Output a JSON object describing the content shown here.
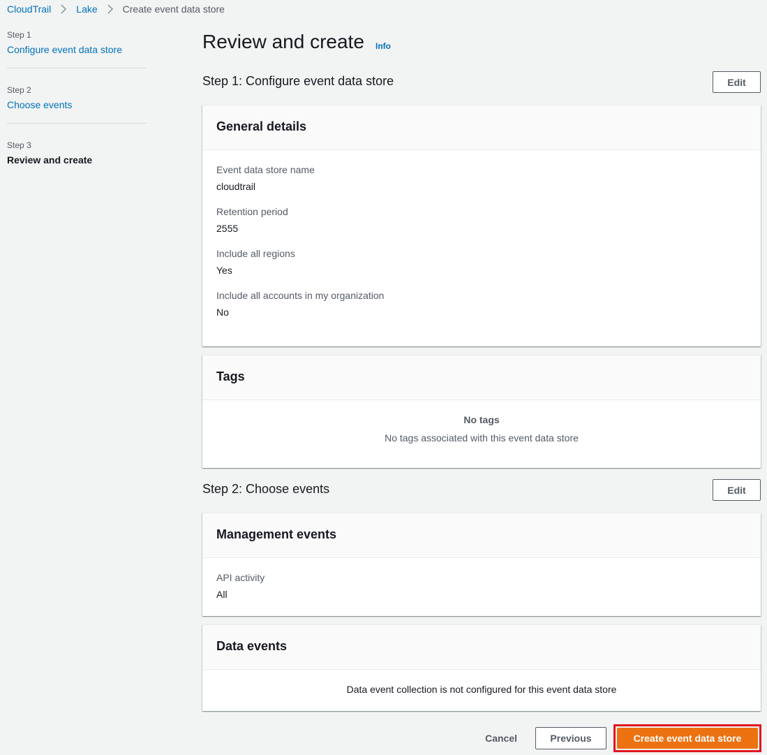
{
  "breadcrumb": {
    "items": [
      "CloudTrail",
      "Lake"
    ],
    "current": "Create event data store"
  },
  "steps": [
    {
      "num": "Step 1",
      "label": "Configure event data store"
    },
    {
      "num": "Step 2",
      "label": "Choose events"
    },
    {
      "num": "Step 3",
      "label": "Review and create"
    }
  ],
  "page": {
    "title": "Review and create",
    "info": "Info"
  },
  "section1": {
    "title": "Step 1: Configure event data store",
    "edit": "Edit",
    "general": {
      "title": "General details",
      "fields": [
        {
          "label": "Event data store name",
          "value": "cloudtrail"
        },
        {
          "label": "Retention period",
          "value": "2555"
        },
        {
          "label": "Include all regions",
          "value": "Yes"
        },
        {
          "label": "Include all accounts in my organization",
          "value": "No"
        }
      ]
    },
    "tags": {
      "title": "Tags",
      "empty_title": "No tags",
      "empty_desc": "No tags associated with this event data store"
    }
  },
  "section2": {
    "title": "Step 2: Choose events",
    "edit": "Edit",
    "management": {
      "title": "Management events",
      "fields": [
        {
          "label": "API activity",
          "value": "All"
        }
      ]
    },
    "data_events": {
      "title": "Data events",
      "message": "Data event collection is not configured for this event data store"
    }
  },
  "footer": {
    "cancel": "Cancel",
    "previous": "Previous",
    "create": "Create event data store"
  },
  "colors": {
    "link": "#0073bb",
    "primary": "#ec7211",
    "highlight": "#e0161e"
  }
}
